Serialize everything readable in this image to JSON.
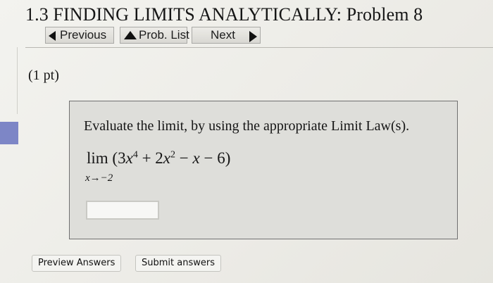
{
  "header": {
    "title": "1.3 FINDING LIMITS ANALYTICALLY: Problem 8"
  },
  "nav": {
    "previous_label": "Previous",
    "prob_list_label": "Prob. List",
    "next_label": "Next"
  },
  "problem": {
    "points": "(1 pt)",
    "prompt": "Evaluate the limit, by using the appropriate Limit Law(s).",
    "expression": {
      "operator": "lim",
      "open": " (3",
      "x1": "x",
      "exp1": "4",
      "mid": " + 2",
      "x2": "x",
      "exp2": "2",
      "tail_minus1": " − ",
      "x3": "x",
      "tail_rest": " − 6)",
      "subscript": "x→−2"
    },
    "answer_value": ""
  },
  "actions": {
    "preview_label": "Preview Answers",
    "submit_label": "Submit answers"
  },
  "colors": {
    "sidebar_accent": "#7d86c6",
    "problem_background": "#dededa"
  }
}
